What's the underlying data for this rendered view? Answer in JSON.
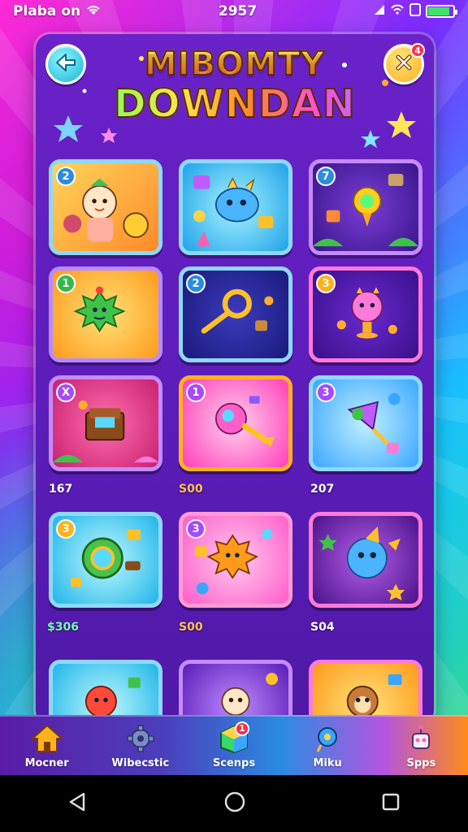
{
  "status_bar": {
    "left_text": "Plaba on",
    "time": "2957"
  },
  "header": {
    "title_line1": "MIBOMTY",
    "title_line2": "DOWNDAN",
    "close_badge": "4"
  },
  "tiles": [
    {
      "badge": "2",
      "value": ""
    },
    {
      "badge": "",
      "value": ""
    },
    {
      "badge": "7",
      "value": ""
    },
    {
      "badge": "1",
      "value": ""
    },
    {
      "badge": "2",
      "value": ""
    },
    {
      "badge": "3",
      "value": ""
    },
    {
      "badge": "X",
      "value": "167"
    },
    {
      "badge": "1",
      "value": "S00"
    },
    {
      "badge": "3",
      "value": "207"
    },
    {
      "badge": "3",
      "value": "$306"
    },
    {
      "badge": "3",
      "value": "S00"
    },
    {
      "badge": "",
      "value": "S04"
    },
    {
      "badge": "",
      "value": ""
    },
    {
      "badge": "",
      "value": ""
    },
    {
      "badge": "",
      "value": ""
    }
  ],
  "bottom_nav": [
    {
      "label": "Mocner",
      "icon": "home-icon"
    },
    {
      "label": "Wibecstic",
      "icon": "gear-icon"
    },
    {
      "label": "Scenps",
      "icon": "cube-icon",
      "badge": "1"
    },
    {
      "label": "Miku",
      "icon": "pin-icon"
    },
    {
      "label": "Spps",
      "icon": "robot-icon"
    }
  ],
  "colors": {
    "panel": "#5a1cb8",
    "accent_yellow": "#ffb21d",
    "accent_cyan": "#17b6d6"
  }
}
